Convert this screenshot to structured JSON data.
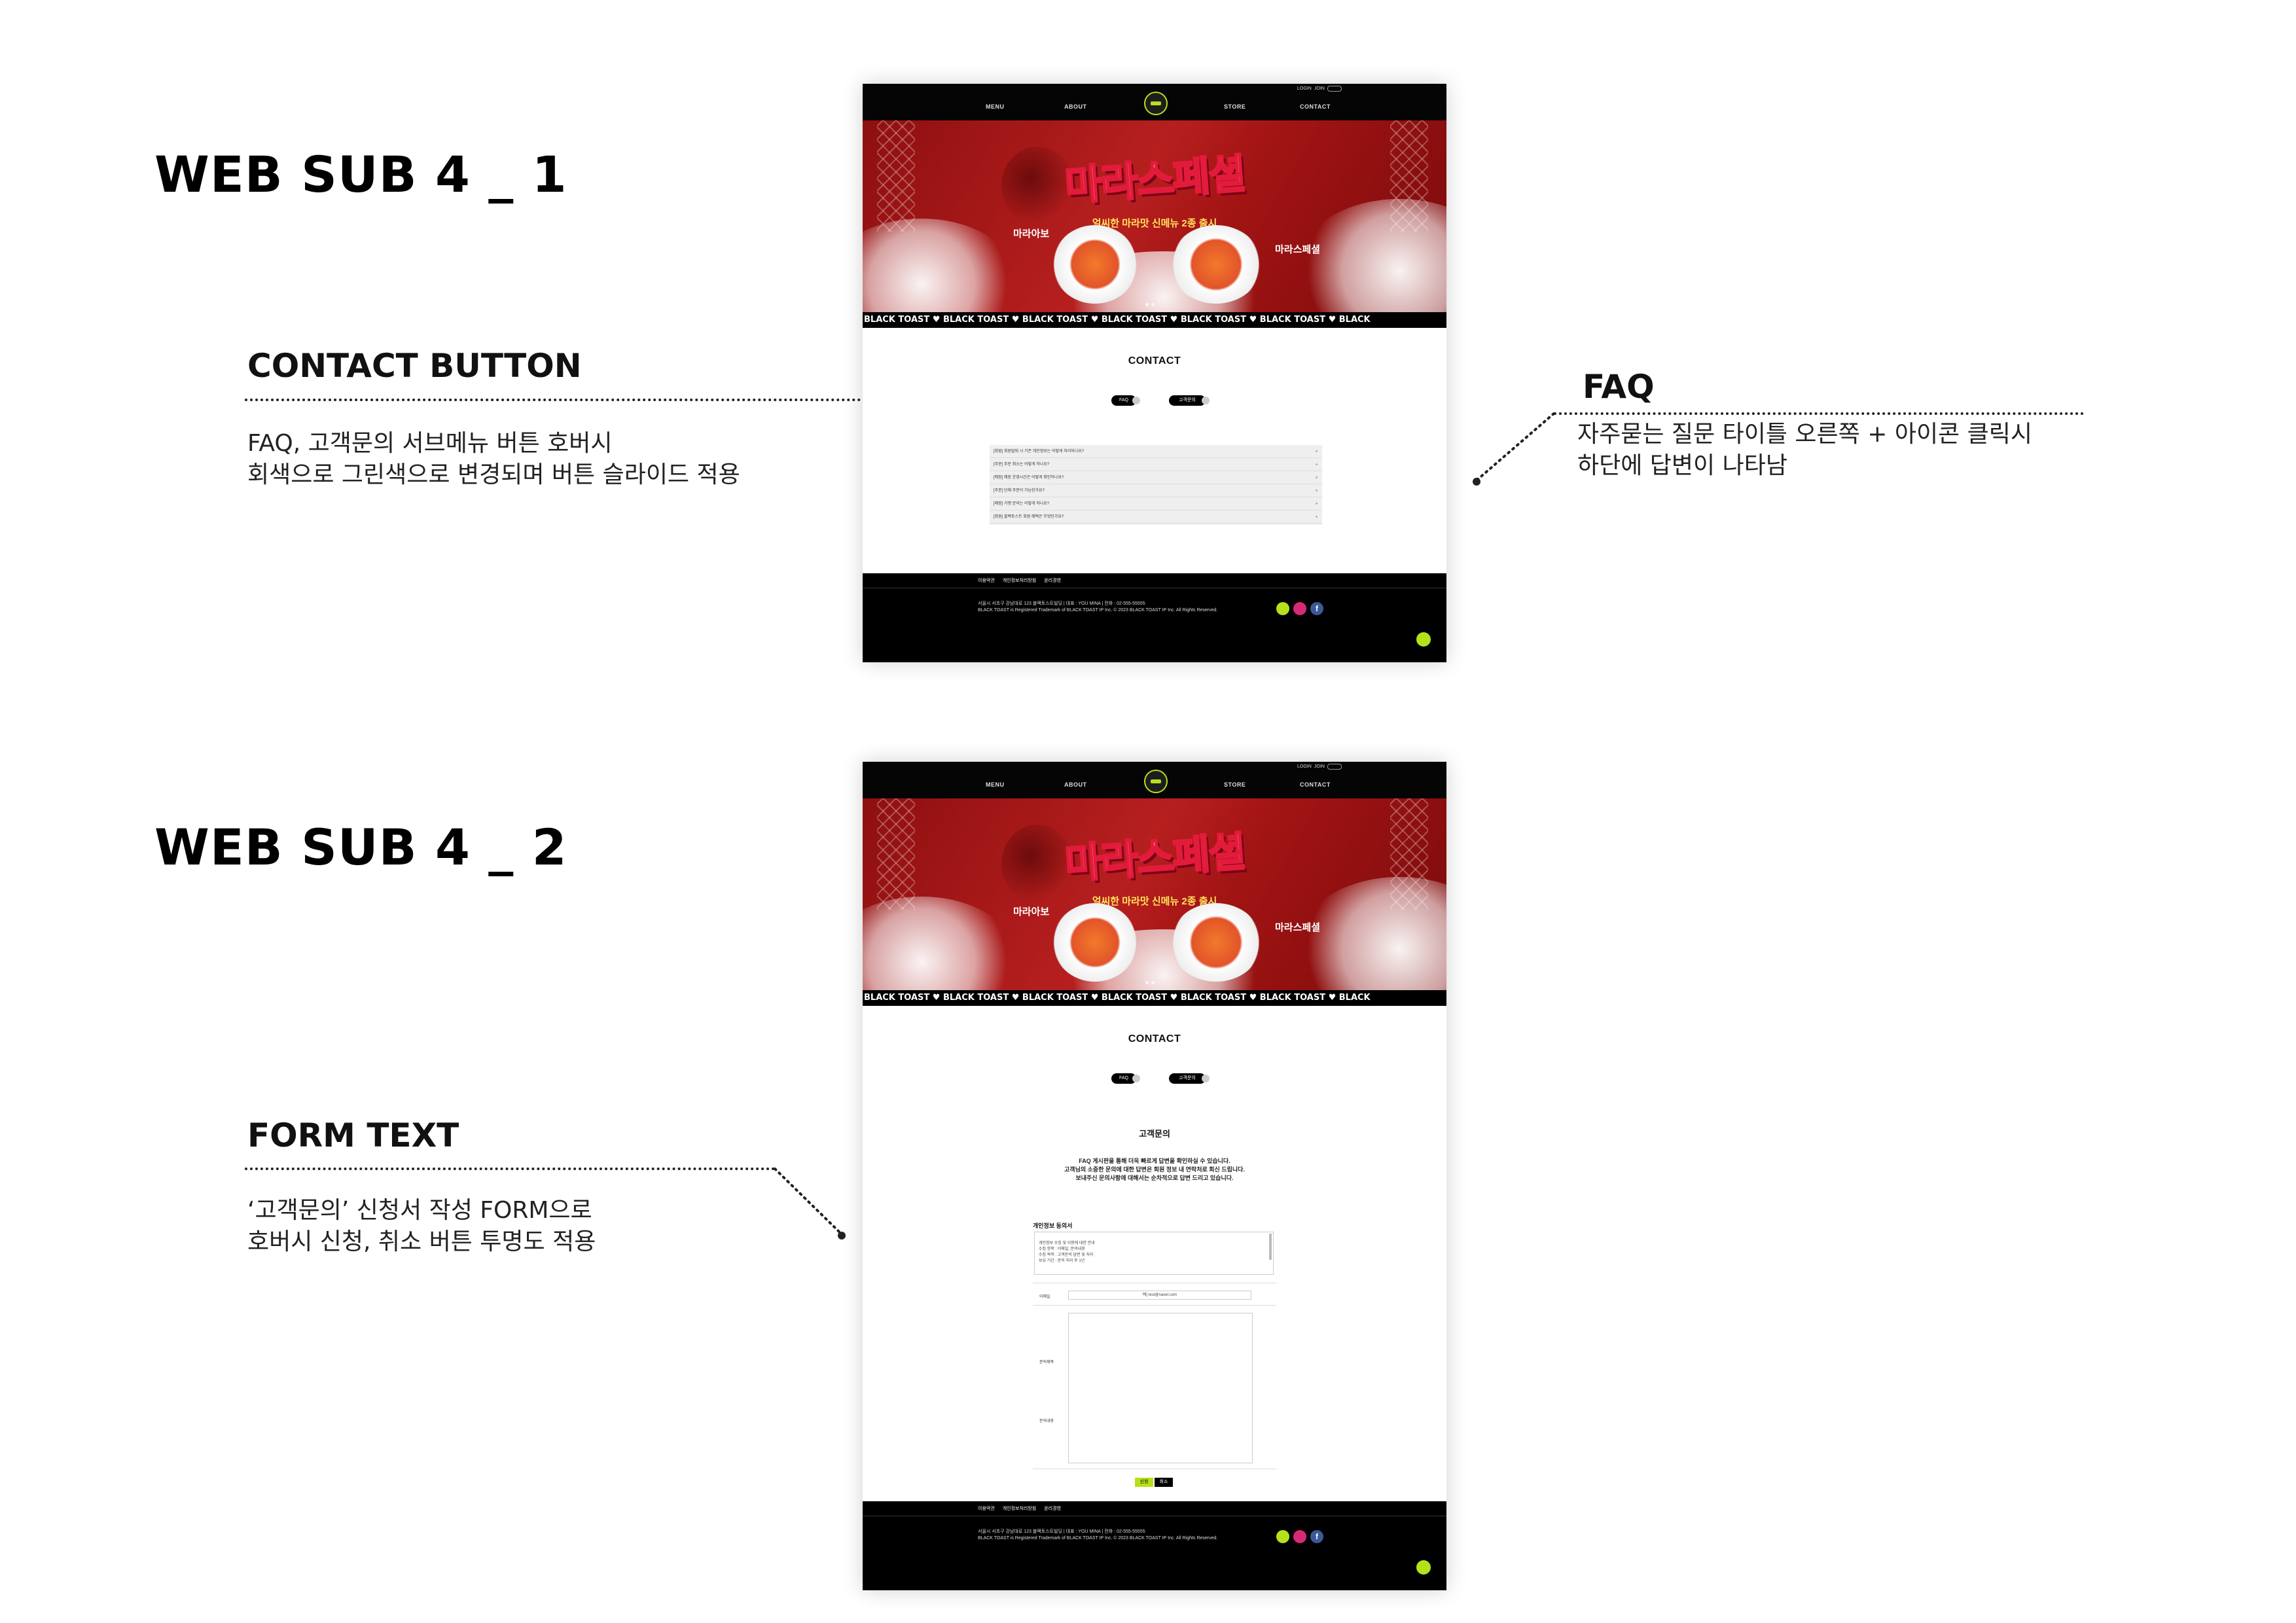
{
  "sections": [
    {
      "title": "WEB SUB 4 _ 1"
    },
    {
      "title": "WEB SUB 4 _ 2"
    }
  ],
  "annotations": {
    "contact_button": {
      "title": "CONTACT BUTTON",
      "desc": "FAQ, 고객문의 서브메뉴 버튼 호버시\n회색으로 그린색으로 변경되며 버튼 슬라이드 적용"
    },
    "faq": {
      "title": "FAQ",
      "desc": "자주묻는 질문 타이틀 오른쪽  + 아이콘 클릭시\n하단에 답변이 나타남"
    },
    "form_text": {
      "title": "FORM TEXT",
      "desc": "‘고객문의’ 신청서 작성 FORM으로\n호버시 신청, 취소 버튼 투명도 적용"
    }
  },
  "nav": {
    "items": [
      "MENU",
      "ABOUT",
      "STORE",
      "CONTACT"
    ],
    "login": "LOGIN",
    "join": "JOIN"
  },
  "hero": {
    "headline": "마라스페셜",
    "sub": "얼씨한 마라맛 신메뉴 2종 출시",
    "menu_left": "마라아보",
    "menu_right": "마라스페셜"
  },
  "ticker": "BLACK TOAST ♥ BLACK TOAST ♥ BLACK TOAST ♥ BLACK TOAST ♥ BLACK TOAST ♥ BLACK TOAST ♥ BLACK",
  "contact": {
    "heading": "CONTACT",
    "tabs": [
      "FAQ",
      "고객문의"
    ]
  },
  "faq_items": [
    "[회원] 회원탈퇴 시 기존 개인정보는 어떻게 처리되나요?",
    "[주문] 주문 취소는 어떻게 하나요?",
    "[매장] 매장 운영시간은 어떻게 확인하나요?",
    "[주문] 단체 주문이 가능한가요?",
    "[매장] 가맹 문의는 어떻게 하나요?",
    "[회원] 블랙토스트 회원 혜택은 무엇인가요?"
  ],
  "form": {
    "title": "고객문의",
    "intro": "FAQ 게시판을 통해 더욱 빠르게 답변을 확인하실 수 있습니다.\n고객님의 소중한 문의에 대한 답변은 회원 정보 내 연락처로 회신 드립니다.\n보내주신 문의사항에 대해서는 순차적으로 답변 드리고 있습니다.",
    "privacy_label": "개인정보 동의서",
    "privacy_text": "개인정보 수집 및 이용에 대한 안내\n수집 항목 : 이메일, 문의내용\n수집 목적 : 고객문의 답변 및 처리\n보유 기간 : 문의 처리 후 1년",
    "email_label": "이메일",
    "email_placeholder": "예) test@naver.com",
    "title_label": "문의제목",
    "content_label": "문의내용",
    "submit": "신청",
    "cancel": "취소"
  },
  "footer": {
    "links": [
      "이용약관",
      "개인정보처리방침",
      "윤리경영"
    ],
    "info": "서울시 서초구 강남대로 123 블랙토스트빌딩 | 대표 : YOU MINA | 전화 : 02-555-55555\nBLACK TOAST is Registered Trademark of BLACK TOAST IP Inc. © 2023 BLACK TOAST IP Inc. All Rights Reserved."
  }
}
